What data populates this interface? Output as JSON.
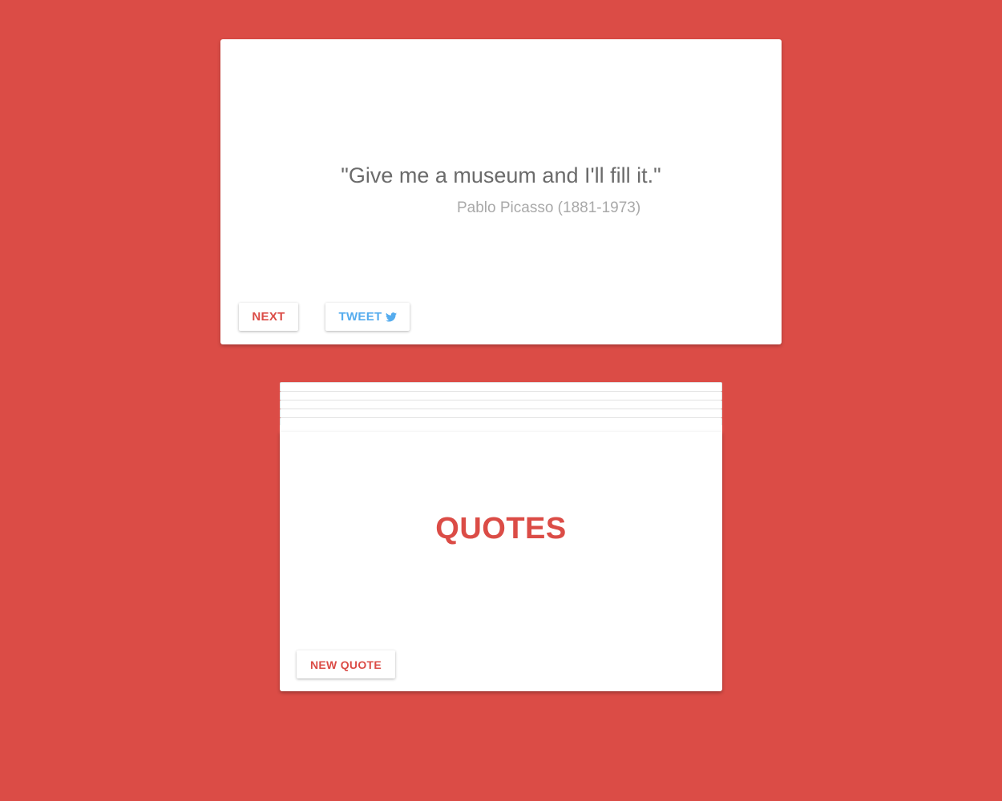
{
  "quote": {
    "text": "\"Give me a museum and I'll fill it.\"",
    "author": "Pablo Picasso (1881-1973)"
  },
  "actions": {
    "next_label": "NEXT",
    "tweet_label": "TWEET",
    "tweet_icon": "twitter-bird-icon"
  },
  "title_card": {
    "title": "QUOTES",
    "new_quote_label": "NEW QUOTE"
  },
  "colors": {
    "background": "#db4c46",
    "accent": "#db4c46",
    "tweet": "#55acee",
    "quote_text": "#6b6b6b",
    "author_text": "#a9a9a9"
  }
}
